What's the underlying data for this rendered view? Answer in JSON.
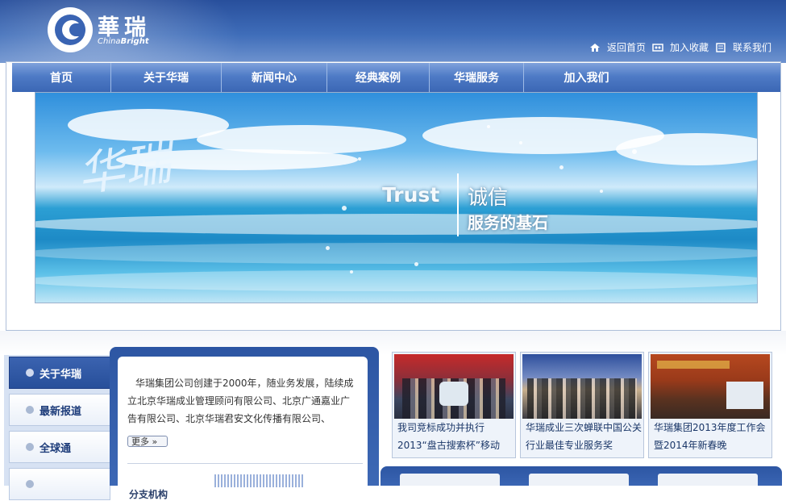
{
  "header": {
    "logo_cn": "華瑞",
    "logo_en_prefix": "China",
    "logo_en_bold": "Bright",
    "links": [
      "返回首页",
      "加入收藏",
      "联系我们"
    ]
  },
  "nav": {
    "items": [
      "首页",
      "关于华瑞",
      "新闻中心",
      "经典案例",
      "华瑞服务",
      "加入我们"
    ]
  },
  "banner": {
    "brush_text": "华瑞",
    "trust": "Trust",
    "chengxin": "诚信",
    "slogan": "服务的基石"
  },
  "sidebar": {
    "items": [
      "关于华瑞",
      "最新报道",
      "全球通"
    ]
  },
  "about": {
    "text": "华瑞集团公司创建于2000年，随业务发展，陆续成立北京华瑞成业管理顾问有限公司、北京广通嘉业广告有限公司、北京华瑞君安文化传播有限公司、",
    "more": "更多",
    "sub": "分支机构"
  },
  "news": [
    {
      "caption": "我司竞标成功并执行 2013“盘古搜索杯”移动"
    },
    {
      "caption": "华瑞成业三次蝉联中国公关行业最佳专业服务奖"
    },
    {
      "caption": "华瑞集团2013年度工作会暨2014年新春晚"
    }
  ],
  "colors": {
    "header_blue": "#284f9c",
    "nav_blue": "#4f7bc6",
    "side_active": "#2b53a0"
  }
}
